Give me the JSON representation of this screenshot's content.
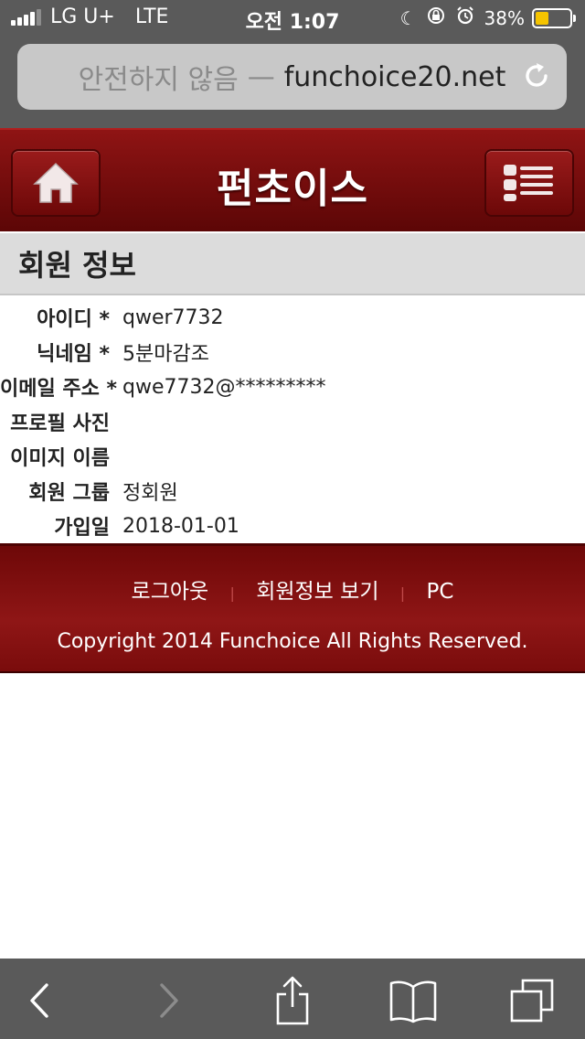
{
  "status_bar": {
    "carrier": "LG U+",
    "network": "LTE",
    "time": "오전 1:07",
    "battery": "38%",
    "battery_level": 0.38
  },
  "url_bar": {
    "security_text": "안전하지 않음",
    "separator": "—",
    "domain": "funchoice20.net"
  },
  "header": {
    "title": "펀초이스",
    "home_icon": "home-icon",
    "menu_icon": "menu-list-icon"
  },
  "section": {
    "title": "회원 정보"
  },
  "member_info": {
    "rows": [
      {
        "label": "아이디 *",
        "value": "qwer7732"
      },
      {
        "label": "닉네임 *",
        "value": "5분마감조"
      },
      {
        "label": "이메일 주소 *",
        "value": "qwe7732@*********"
      },
      {
        "label": "프로필 사진",
        "value": ""
      },
      {
        "label": "이미지 이름",
        "value": ""
      },
      {
        "label": "회원 그룹",
        "value": "정회원"
      },
      {
        "label": "가입일",
        "value": "2018-01-01"
      }
    ]
  },
  "footer": {
    "links": [
      "로그아웃",
      "회원정보 보기",
      "PC"
    ],
    "separator": "|",
    "copyright": "Copyright 2014 Funchoice All Rights Reserved."
  },
  "toolbar": {
    "icons": [
      "back-icon",
      "forward-icon",
      "share-icon",
      "bookmarks-icon",
      "tabs-icon"
    ]
  },
  "colors": {
    "brand_red": "#8f1414",
    "battery_yellow": "#f5c400"
  }
}
